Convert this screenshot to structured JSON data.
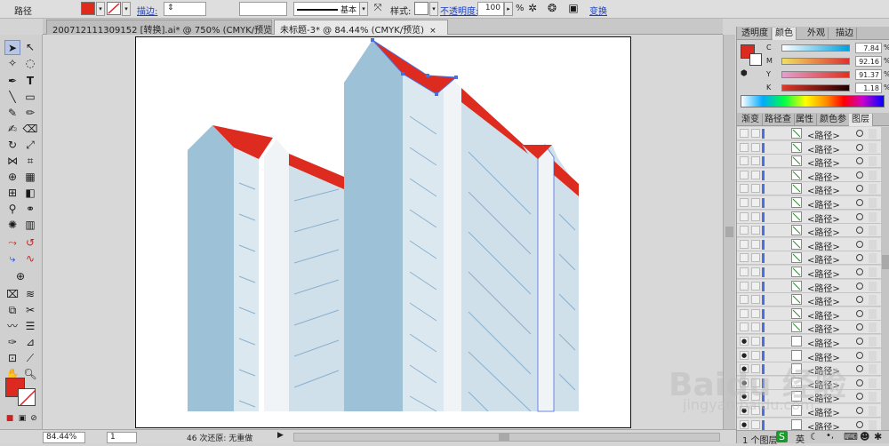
{
  "control_bar": {
    "label": "路径",
    "stroke_label": "描边:",
    "stroke_profile": "基本",
    "style_label": "样式:",
    "opacity_label": "不透明度:",
    "opacity_value": "100",
    "opacity_unit": "%",
    "transform_label": "变换",
    "fill_color": "#e02a1c"
  },
  "doc_tabs": [
    {
      "label": "200712111309152 [转换].ai* @ 750% (CMYK/预览)",
      "close": "×"
    },
    {
      "label": "未标题-3* @ 84.44% (CMYK/预览)",
      "close": "×"
    }
  ],
  "status_bar": {
    "zoom": "84.44%",
    "artboard": "1",
    "info": "46 次还原: 无重做"
  },
  "color_panel": {
    "tabs": [
      "透明度",
      "颜色",
      "外观",
      "描边"
    ],
    "rows": [
      {
        "channel": "C",
        "value": "7.84",
        "unit": "%"
      },
      {
        "channel": "M",
        "value": "92.16",
        "unit": "%"
      },
      {
        "channel": "Y",
        "value": "91.37",
        "unit": "%"
      },
      {
        "channel": "K",
        "value": "1.18",
        "unit": "%"
      }
    ],
    "fill_color": "#dc2a20"
  },
  "layers_panel": {
    "tabs": [
      "渐变",
      "路径查",
      "属性",
      "颜色参",
      "图层"
    ],
    "items": [
      {
        "name": "<路径>"
      },
      {
        "name": "<路径>"
      },
      {
        "name": "<路径>"
      },
      {
        "name": "<路径>"
      },
      {
        "name": "<路径>"
      },
      {
        "name": "<路径>"
      },
      {
        "name": "<路径>"
      },
      {
        "name": "<路径>"
      },
      {
        "name": "<路径>"
      },
      {
        "name": "<路径>"
      },
      {
        "name": "<路径>"
      },
      {
        "name": "<路径>"
      },
      {
        "name": "<路径>"
      },
      {
        "name": "<路径>"
      },
      {
        "name": "<路径>"
      },
      {
        "name": "<路径>"
      },
      {
        "name": "<路径>"
      },
      {
        "name": "<路径>"
      },
      {
        "name": "<路径>"
      },
      {
        "name": "<路径>"
      },
      {
        "name": "<路径>"
      },
      {
        "name": "<路径>"
      },
      {
        "name": "<路径>"
      }
    ],
    "footer": "1 个图层"
  },
  "watermark": {
    "main": "Baidu 经验",
    "sub": "jingyan.baidu.com"
  },
  "taskbar": {
    "ime": "英"
  }
}
